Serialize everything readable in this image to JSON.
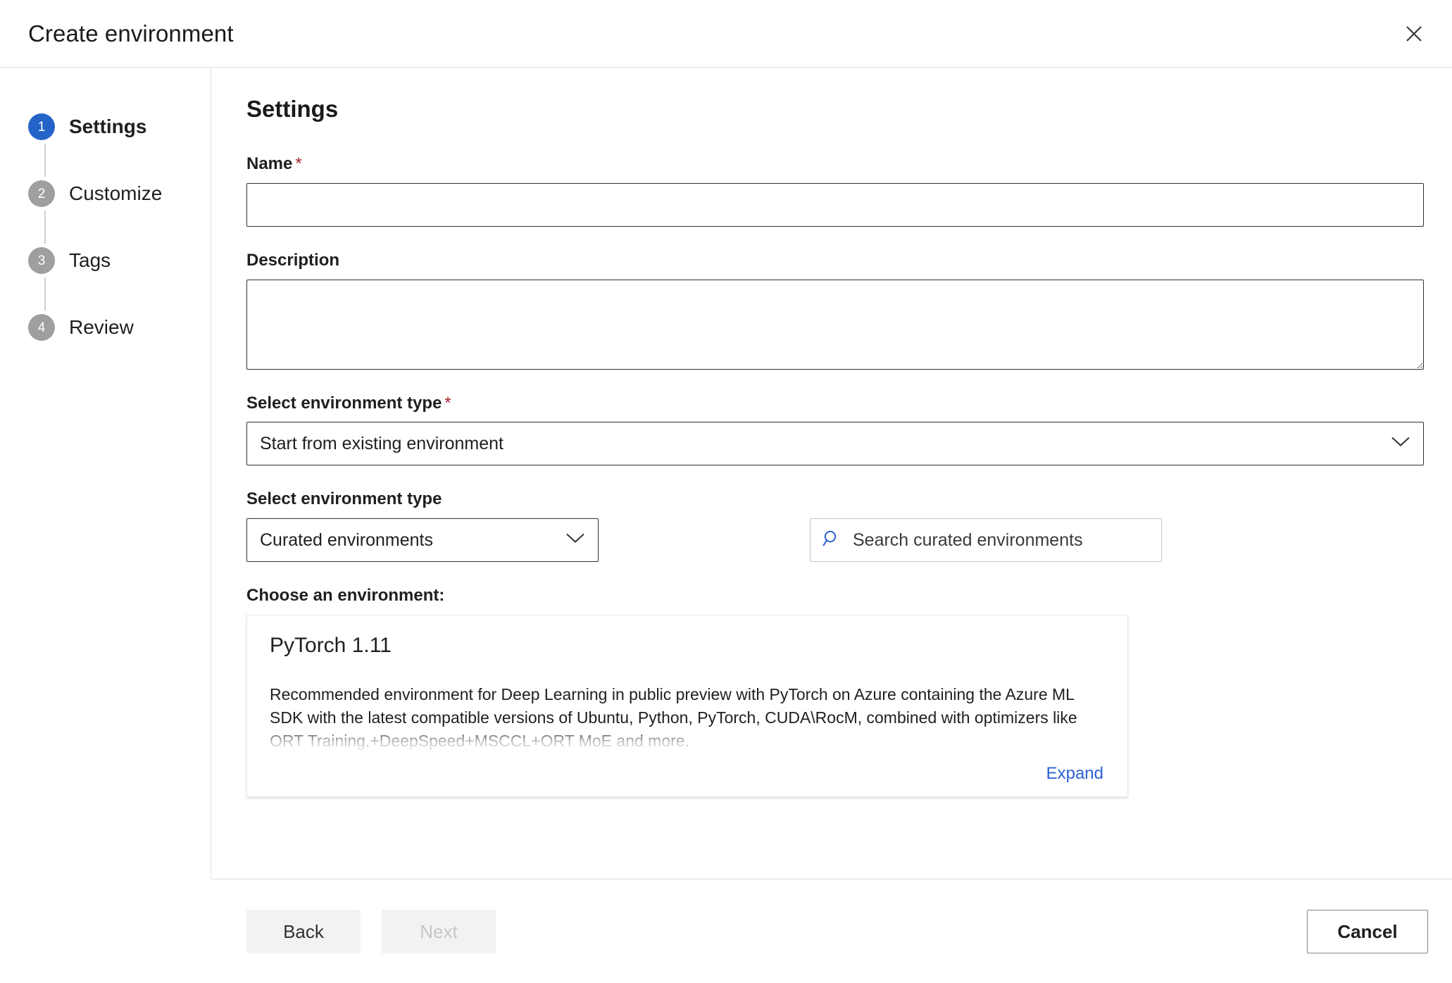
{
  "header": {
    "title": "Create environment",
    "close_icon": "close-icon"
  },
  "wizard": {
    "steps": [
      {
        "number": "1",
        "label": "Settings",
        "active": true
      },
      {
        "number": "2",
        "label": "Customize",
        "active": false
      },
      {
        "number": "3",
        "label": "Tags",
        "active": false
      },
      {
        "number": "4",
        "label": "Review",
        "active": false
      }
    ]
  },
  "content": {
    "heading": "Settings",
    "name_field": {
      "label": "Name",
      "required_mark": "*",
      "value": "",
      "placeholder": ""
    },
    "description_field": {
      "label": "Description",
      "value": "",
      "placeholder": ""
    },
    "environment_type": {
      "label": "Select environment type",
      "required_mark": "*",
      "selected": "Start from existing environment",
      "chevron_icon": "chevron-down-icon"
    },
    "environment_source": {
      "label": "Select environment type",
      "selected": "Curated environments",
      "chevron_icon": "chevron-down-icon"
    },
    "search": {
      "placeholder": "Search curated environments",
      "value": "",
      "icon": "search-icon"
    },
    "choose_label": "Choose an environment:",
    "environment_card": {
      "title": "PyTorch 1.11",
      "description": "Recommended environment for Deep Learning in public preview with PyTorch on Azure containing the Azure ML SDK with the latest compatible versions of Ubuntu, Python, PyTorch, CUDA\\RocM, combined with optimizers like ORT Training,+DeepSpeed+MSCCL+ORT MoE and more.",
      "expand_label": "Expand"
    }
  },
  "footer": {
    "back_label": "Back",
    "next_label": "Next",
    "next_disabled": true,
    "cancel_label": "Cancel"
  },
  "colors": {
    "accent": "#2464c8",
    "link": "#2b62d4",
    "required": "#a4262c",
    "step_inactive": "#a19f9d",
    "border": "#e1e1e1"
  }
}
